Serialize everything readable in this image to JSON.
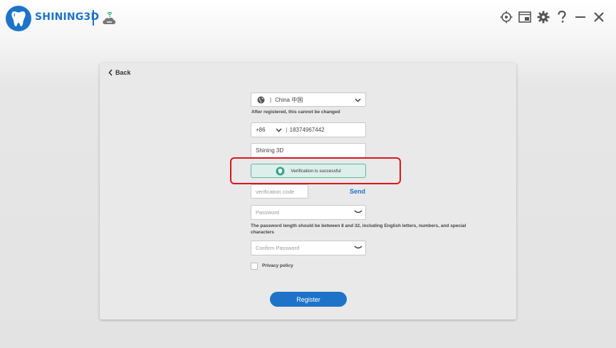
{
  "app": {
    "brand": "SHINING3D"
  },
  "nav": {
    "back_label": "Back"
  },
  "form": {
    "country_value": "China 中国",
    "country_hint": "After registered, this cannot be changed",
    "phone_code": "+86",
    "phone_number": "18374967442",
    "name_value": "Shining 3D",
    "verification_status": "Verification is successful",
    "verification_code_placeholder": "verification code",
    "send_label": "Send",
    "password_placeholder": "Password",
    "password_hint": "The password length should be between 8 and 32, including English letters, numbers, and special characters",
    "confirm_password_placeholder": "Confirm Password",
    "privacy_label": "Privacy policy",
    "register_label": "Register"
  },
  "colors": {
    "accent": "#1e73c9",
    "success_bg": "#dcefeb",
    "success_border": "#5fb8a4",
    "highlight": "#d9161c"
  },
  "icons": [
    "tooth-logo-icon",
    "cloud-wifi-icon",
    "target-icon",
    "screenshot-icon",
    "gear-icon",
    "help-icon",
    "minimize-icon",
    "close-icon",
    "chevron-left-icon",
    "globe-icon",
    "chevron-down-icon",
    "shield-check-icon",
    "eye-closed-icon"
  ]
}
